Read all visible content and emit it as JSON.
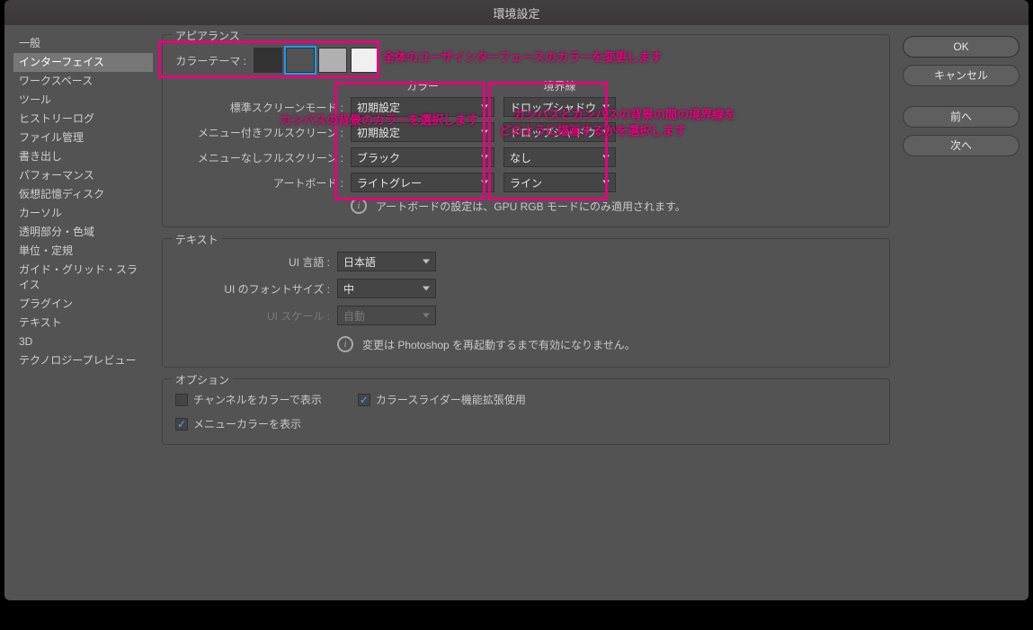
{
  "titlebar": {
    "title": "環境設定"
  },
  "sidebar": {
    "items": [
      "一般",
      "インターフェイス",
      "ワークスペース",
      "ツール",
      "ヒストリーログ",
      "ファイル管理",
      "書き出し",
      "パフォーマンス",
      "仮想記憶ディスク",
      "カーソル",
      "透明部分・色域",
      "単位・定規",
      "ガイド・グリッド・スライス",
      "プラグイン",
      "テキスト",
      "3D",
      "テクノロジープレビュー"
    ],
    "selected_index": 1
  },
  "buttons": {
    "ok": "OK",
    "cancel": "キャンセル",
    "prev": "前へ",
    "next": "次へ"
  },
  "appearance": {
    "group_title": "アピアランス",
    "color_theme_label": "カラーテーマ :",
    "swatches": [
      {
        "color": "#323232",
        "selected": false
      },
      {
        "color": "#535353",
        "selected": true
      },
      {
        "color": "#b0b0b0",
        "selected": false
      },
      {
        "color": "#f0f0f0",
        "selected": false
      }
    ],
    "col_headers": {
      "color": "カラー",
      "border": "境界線"
    },
    "rows": [
      {
        "label": "標準スクリーンモード :",
        "color": "初期設定",
        "border": "ドロップシャドウ"
      },
      {
        "label": "メニュー付きフルスクリーン :",
        "color": "初期設定",
        "border": "ドロップシャドウ"
      },
      {
        "label": "メニューなしフルスクリーン :",
        "color": "ブラック",
        "border": "なし"
      },
      {
        "label": "アートボード :",
        "color": "ライトグレー",
        "border": "ライン"
      }
    ],
    "info_text": "アートボードの設定は、GPU RGB モードにのみ適用されます。"
  },
  "text_group": {
    "title": "テキスト",
    "rows": [
      {
        "label": "UI 言語 :",
        "value": "日本語",
        "disabled": false
      },
      {
        "label": "UI のフォントサイズ :",
        "value": "中",
        "disabled": false
      },
      {
        "label": "UI スケール :",
        "value": "自動",
        "disabled": true
      }
    ],
    "info_text": "変更は Photoshop を再起動するまで有効になりません。"
  },
  "options_group": {
    "title": "オプション",
    "items": [
      {
        "label": "チャンネルをカラーで表示",
        "checked": false
      },
      {
        "label": "カラースライダー機能拡張使用",
        "checked": true
      },
      {
        "label": "メニューカラーを表示",
        "checked": true
      }
    ]
  },
  "annotations": {
    "theme": "全体のユーザインターフェースのカラーを変更します",
    "color_col": "カンバスの背景のカラーを選択します",
    "border_col_line1": "カンバスとカンバスの背景の間の境界線を",
    "border_col_line2": "どのように描画するかを選択します"
  }
}
